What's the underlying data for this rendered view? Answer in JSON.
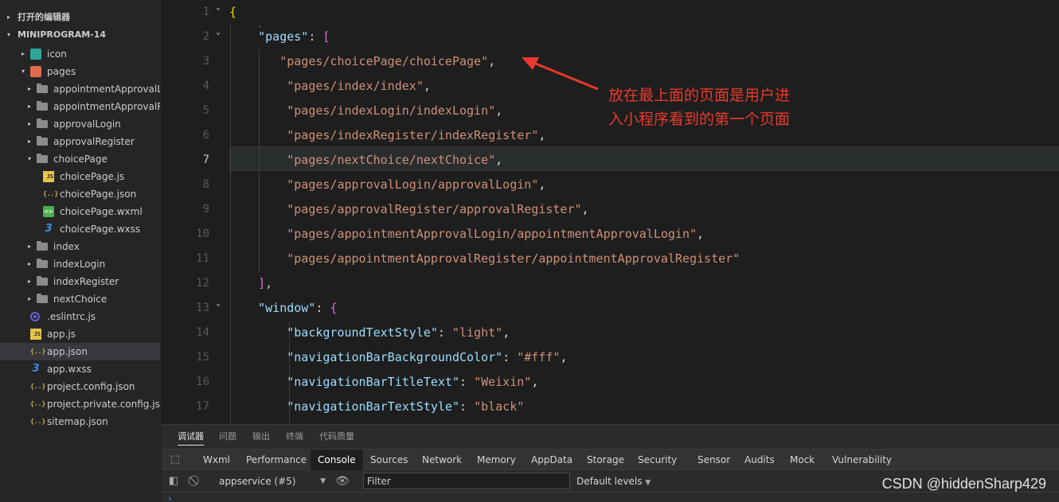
{
  "explorer": {
    "open_editors": "打开的编辑器",
    "project": "MINIPROGRAM-14",
    "items": [
      {
        "label": "icon",
        "kind": "folder-teal",
        "depth": 1,
        "arrow": "▸"
      },
      {
        "label": "pages",
        "kind": "folder-pages",
        "depth": 1,
        "arrow": "▾"
      },
      {
        "label": "appointmentApprovalL...",
        "kind": "folder",
        "depth": 2,
        "arrow": "▸"
      },
      {
        "label": "appointmentApprovalR...",
        "kind": "folder",
        "depth": 2,
        "arrow": "▸"
      },
      {
        "label": "approvalLogin",
        "kind": "folder",
        "depth": 2,
        "arrow": "▸"
      },
      {
        "label": "approvalRegister",
        "kind": "folder",
        "depth": 2,
        "arrow": "▸"
      },
      {
        "label": "choicePage",
        "kind": "folder",
        "depth": 2,
        "arrow": "▾"
      },
      {
        "label": "choicePage.js",
        "kind": "js",
        "depth": 3,
        "arrow": ""
      },
      {
        "label": "choicePage.json",
        "kind": "json",
        "depth": 3,
        "arrow": ""
      },
      {
        "label": "choicePage.wxml",
        "kind": "wxml",
        "depth": 3,
        "arrow": ""
      },
      {
        "label": "choicePage.wxss",
        "kind": "wxss",
        "depth": 3,
        "arrow": ""
      },
      {
        "label": "index",
        "kind": "folder",
        "depth": 2,
        "arrow": "▸"
      },
      {
        "label": "indexLogin",
        "kind": "folder",
        "depth": 2,
        "arrow": "▸"
      },
      {
        "label": "indexRegister",
        "kind": "folder",
        "depth": 2,
        "arrow": "▸"
      },
      {
        "label": "nextChoice",
        "kind": "folder",
        "depth": 2,
        "arrow": "▸"
      },
      {
        "label": ".eslintrc.js",
        "kind": "eslint",
        "depth": 1,
        "arrow": ""
      },
      {
        "label": "app.js",
        "kind": "js",
        "depth": 1,
        "arrow": ""
      },
      {
        "label": "app.json",
        "kind": "json",
        "depth": 1,
        "arrow": "",
        "active": true
      },
      {
        "label": "app.wxss",
        "kind": "wxss",
        "depth": 1,
        "arrow": ""
      },
      {
        "label": "project.config.json",
        "kind": "json",
        "depth": 1,
        "arrow": ""
      },
      {
        "label": "project.private.config.json",
        "kind": "json",
        "depth": 1,
        "arrow": ""
      },
      {
        "label": "sitemap.json",
        "kind": "json",
        "depth": 1,
        "arrow": ""
      }
    ]
  },
  "editor": {
    "current_line": 7,
    "lines": [
      {
        "n": "1",
        "fold": "⌄",
        "tokens": [
          {
            "t": "{",
            "c": "b1"
          }
        ]
      },
      {
        "n": "2",
        "fold": "⌄",
        "tokens": [
          {
            "t": "    ",
            "c": "p"
          },
          {
            "t": "\"pages\"",
            "c": "k"
          },
          {
            "t": ": ",
            "c": "p"
          },
          {
            "t": "[",
            "c": "b2"
          }
        ]
      },
      {
        "n": "3",
        "fold": "",
        "tokens": [
          {
            "t": "       ",
            "c": "p"
          },
          {
            "t": "\"pages/choicePage/choicePage\"",
            "c": "s"
          },
          {
            "t": ",",
            "c": "p"
          }
        ]
      },
      {
        "n": "4",
        "fold": "",
        "tokens": [
          {
            "t": "        ",
            "c": "p"
          },
          {
            "t": "\"pages/index/index\"",
            "c": "s"
          },
          {
            "t": ",",
            "c": "p"
          }
        ]
      },
      {
        "n": "5",
        "fold": "",
        "tokens": [
          {
            "t": "        ",
            "c": "p"
          },
          {
            "t": "\"pages/indexLogin/indexLogin\"",
            "c": "s"
          },
          {
            "t": ",",
            "c": "p"
          }
        ]
      },
      {
        "n": "6",
        "fold": "",
        "tokens": [
          {
            "t": "        ",
            "c": "p"
          },
          {
            "t": "\"pages/indexRegister/indexRegister\"",
            "c": "s"
          },
          {
            "t": ",",
            "c": "p"
          }
        ]
      },
      {
        "n": "7",
        "fold": "",
        "tokens": [
          {
            "t": "        ",
            "c": "p"
          },
          {
            "t": "\"pages/nextChoice/nextChoice\"",
            "c": "s"
          },
          {
            "t": ",",
            "c": "p"
          }
        ]
      },
      {
        "n": "8",
        "fold": "",
        "tokens": [
          {
            "t": "        ",
            "c": "p"
          },
          {
            "t": "\"pages/approvalLogin/approvalLogin\"",
            "c": "s"
          },
          {
            "t": ",",
            "c": "p"
          }
        ]
      },
      {
        "n": "9",
        "fold": "",
        "tokens": [
          {
            "t": "        ",
            "c": "p"
          },
          {
            "t": "\"pages/approvalRegister/approvalRegister\"",
            "c": "s"
          },
          {
            "t": ",",
            "c": "p"
          }
        ]
      },
      {
        "n": "10",
        "fold": "",
        "tokens": [
          {
            "t": "        ",
            "c": "p"
          },
          {
            "t": "\"pages/appointmentApprovalLogin/appointmentApprovalLogin\"",
            "c": "s"
          },
          {
            "t": ",",
            "c": "p"
          }
        ]
      },
      {
        "n": "11",
        "fold": "",
        "tokens": [
          {
            "t": "        ",
            "c": "p"
          },
          {
            "t": "\"pages/appointmentApprovalRegister/appointmentApprovalRegister\"",
            "c": "s"
          }
        ]
      },
      {
        "n": "12",
        "fold": "",
        "tokens": [
          {
            "t": "    ",
            "c": "p"
          },
          {
            "t": "]",
            "c": "b2"
          },
          {
            "t": ",",
            "c": "p"
          }
        ]
      },
      {
        "n": "13",
        "fold": "⌄",
        "tokens": [
          {
            "t": "    ",
            "c": "p"
          },
          {
            "t": "\"window\"",
            "c": "k"
          },
          {
            "t": ": ",
            "c": "p"
          },
          {
            "t": "{",
            "c": "b2"
          }
        ]
      },
      {
        "n": "14",
        "fold": "",
        "tokens": [
          {
            "t": "        ",
            "c": "p"
          },
          {
            "t": "\"backgroundTextStyle\"",
            "c": "k"
          },
          {
            "t": ": ",
            "c": "p"
          },
          {
            "t": "\"light\"",
            "c": "s"
          },
          {
            "t": ",",
            "c": "p"
          }
        ]
      },
      {
        "n": "15",
        "fold": "",
        "tokens": [
          {
            "t": "        ",
            "c": "p"
          },
          {
            "t": "\"navigationBarBackgroundColor\"",
            "c": "k"
          },
          {
            "t": ": ",
            "c": "p"
          },
          {
            "t": "\"#fff\"",
            "c": "s"
          },
          {
            "t": ",",
            "c": "p"
          }
        ]
      },
      {
        "n": "16",
        "fold": "",
        "tokens": [
          {
            "t": "        ",
            "c": "p"
          },
          {
            "t": "\"navigationBarTitleText\"",
            "c": "k"
          },
          {
            "t": ": ",
            "c": "p"
          },
          {
            "t": "\"Weixin\"",
            "c": "s"
          },
          {
            "t": ",",
            "c": "p"
          }
        ]
      },
      {
        "n": "17",
        "fold": "",
        "tokens": [
          {
            "t": "        ",
            "c": "p"
          },
          {
            "t": "\"navigationBarTextStyle\"",
            "c": "k"
          },
          {
            "t": ": ",
            "c": "p"
          },
          {
            "t": "\"black\"",
            "c": "s"
          }
        ]
      }
    ]
  },
  "annotation": {
    "line1": "放在最上面的页面是用户进",
    "line2": "入小程序看到的第一个页面"
  },
  "bottom_tabs": [
    "调试器",
    "问题",
    "输出",
    "终端",
    "代码质量"
  ],
  "devtools_tabs": [
    "Wxml",
    "Performance",
    "Console",
    "Sources",
    "Network",
    "Memory",
    "AppData",
    "Storage",
    "Security",
    "Sensor",
    "Audits",
    "Mock",
    "Vulnerability"
  ],
  "console": {
    "context": "appservice (#5)",
    "filter_placeholder": "Filter",
    "levels": "Default levels",
    "prompt": "›"
  },
  "watermark": "CSDN @hiddenSharp429"
}
